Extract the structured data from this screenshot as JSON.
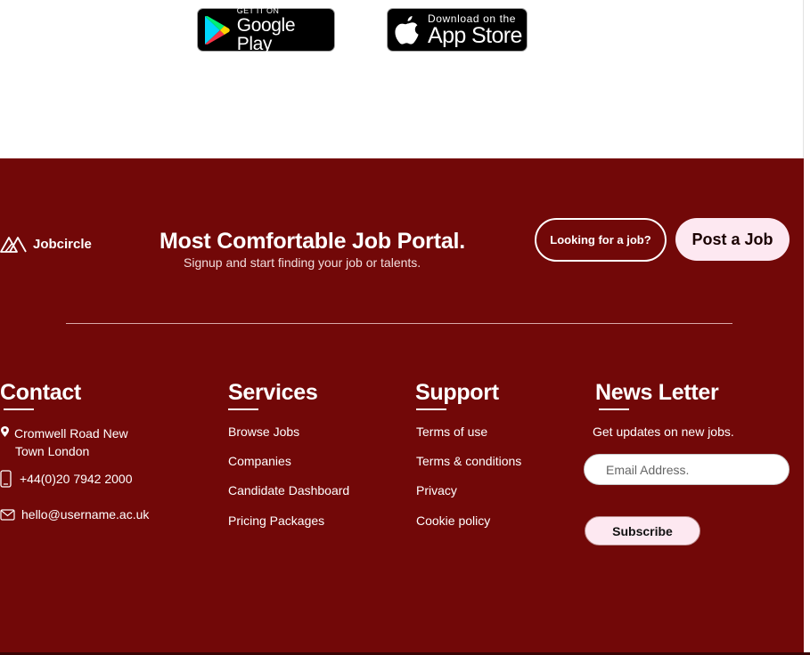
{
  "store_badges": {
    "google_play": {
      "small": "GET IT ON",
      "big": "Google Play"
    },
    "app_store": {
      "small": "Download on the",
      "big": "App Store"
    }
  },
  "brand": {
    "name": "Jobcircle",
    "icon": "mountain-logo-icon"
  },
  "tagline": {
    "headline": "Most Comfortable Job Portal.",
    "sub": "Signup and start finding your job or talents."
  },
  "cta": {
    "looking_label": "Looking for a job?",
    "post_label": "Post a Job"
  },
  "contact": {
    "title": "Contact",
    "address_line1": "Cromwell Road New",
    "address_line2": "Town London",
    "phone": "+44(0)20 7942 2000",
    "email": "hello@username.ac.uk"
  },
  "services": {
    "title": "Services",
    "links": [
      "Browse Jobs",
      "Companies",
      "Candidate Dashboard",
      "Pricing Packages"
    ]
  },
  "support": {
    "title": "Support",
    "links": [
      "Terms of use",
      "Terms & conditions",
      "Privacy",
      "Cookie policy"
    ]
  },
  "newsletter": {
    "title": "News Letter",
    "text": "Get updates on new jobs.",
    "placeholder": "Email Address.",
    "subscribe_label": "Subscribe"
  },
  "colors": {
    "footer_bg": "#720808",
    "button_light": "#fde8f1"
  }
}
